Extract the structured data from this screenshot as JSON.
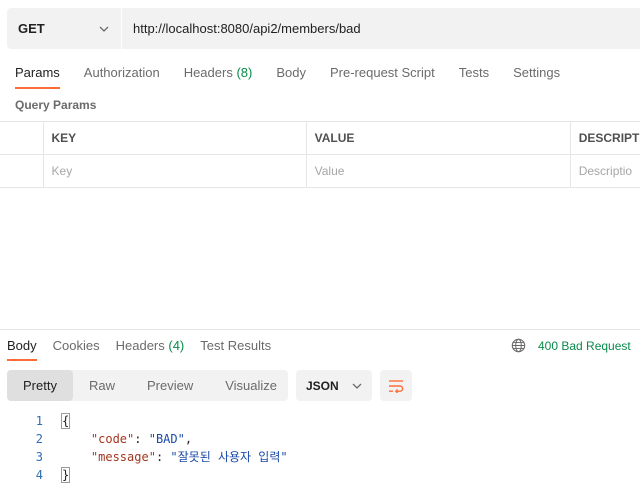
{
  "request": {
    "method": "GET",
    "url": "http://localhost:8080/api2/members/bad"
  },
  "request_tabs": [
    {
      "label": "Params",
      "count": "",
      "active": true
    },
    {
      "label": "Authorization",
      "count": ""
    },
    {
      "label": "Headers",
      "count": "(8)"
    },
    {
      "label": "Body",
      "count": ""
    },
    {
      "label": "Pre-request Script",
      "count": ""
    },
    {
      "label": "Tests",
      "count": ""
    },
    {
      "label": "Settings",
      "count": ""
    }
  ],
  "query_params": {
    "title": "Query Params",
    "columns": [
      "KEY",
      "VALUE",
      "DESCRIPT"
    ],
    "placeholders": [
      "Key",
      "Value",
      "Descriptio"
    ]
  },
  "response_tabs": [
    {
      "label": "Body",
      "count": "",
      "active": true
    },
    {
      "label": "Cookies",
      "count": ""
    },
    {
      "label": "Headers",
      "count": "(4)"
    },
    {
      "label": "Test Results",
      "count": ""
    }
  ],
  "status": {
    "text": "400 Bad Request",
    "icon": "globe-icon"
  },
  "view_modes": [
    "Pretty",
    "Raw",
    "Preview",
    "Visualize"
  ],
  "format": "JSON",
  "code": {
    "line_numbers": [
      "1",
      "2",
      "3",
      "4"
    ],
    "open_brace": "{",
    "close_brace": "}",
    "pairs": [
      {
        "key": "\"code\"",
        "sep": ": ",
        "value": "\"BAD\"",
        "end": ","
      },
      {
        "key": "\"message\"",
        "sep": ": ",
        "value": "\"잘못된 사용자 입력\"",
        "end": ""
      }
    ]
  },
  "colors": {
    "accent": "#ff6c37",
    "success": "#0a8a4a",
    "json_key": "#a3371f",
    "json_string": "#1c4aa8"
  }
}
